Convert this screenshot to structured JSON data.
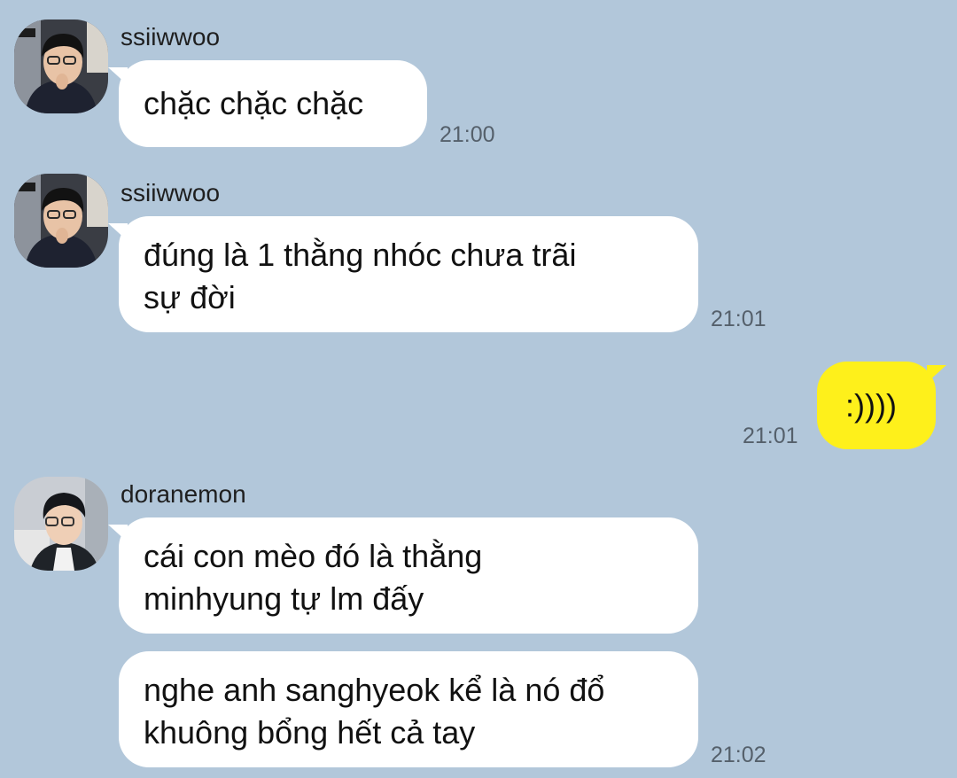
{
  "messages": [
    {
      "sender": "ssiiwwoo",
      "avatar": "avatar-ssiiwwoo",
      "text": "chặc chặc chặc",
      "time": "21:00"
    },
    {
      "sender": "ssiiwwoo",
      "avatar": "avatar-ssiiwwoo",
      "text": "đúng là 1 thằng nhóc chưa trãi\nsự đời",
      "time": "21:01"
    },
    {
      "direction": "outgoing",
      "text": ":))))",
      "time": "21:01"
    },
    {
      "sender": "doranemon",
      "avatar": "avatar-doranemon",
      "text": "cái con mèo đó là thằng\nminhyung tự lm đấy"
    },
    {
      "sender": "doranemon",
      "text": "nghe anh sanghyeok kể là nó đổ\nkhuông bổng hết cả tay",
      "time": "21:02"
    }
  ],
  "colors": {
    "background": "#b2c7da",
    "incoming_bubble": "#ffffff",
    "outgoing_bubble": "#fef01b",
    "time_text": "#55606b"
  }
}
